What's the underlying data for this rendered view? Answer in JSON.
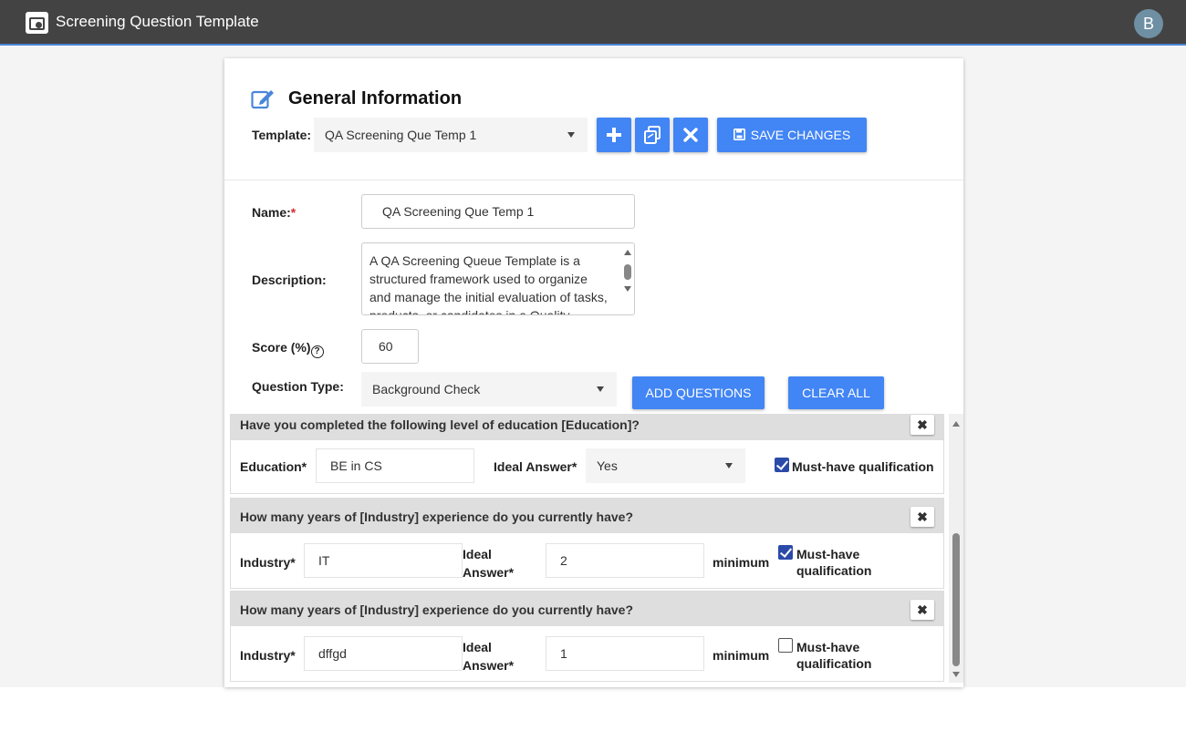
{
  "app": {
    "title": "Screening Question Template",
    "avatar_initial": "B"
  },
  "general": {
    "section_title": "General Information",
    "template_label": "Template:",
    "template_selected": "QA Screening Que Temp 1",
    "save_label": "SAVE CHANGES"
  },
  "form": {
    "name_label": "Name:",
    "name_required_mark": "*",
    "name_value": "QA Screening Que Temp 1",
    "description_label": "Description:",
    "description_value": "A QA Screening Queue Template is a structured framework used to organize and manage the initial evaluation of tasks, products, or candidates in a Quality",
    "score_label": "Score (%)",
    "score_help_icon": "?",
    "score_value": "60",
    "question_type_label": "Question Type:",
    "question_type_selected": "Background Check",
    "add_questions_label": "ADD QUESTIONS",
    "clear_all_label": "CLEAR ALL"
  },
  "questions": [
    {
      "title": "Have you completed the following level of education [Education]?",
      "field_label": "Education*",
      "field_value": "BE in CS",
      "ideal_label": "Ideal Answer*",
      "ideal_value": "Yes",
      "must_have_label": "Must-have qualification",
      "must_have": true
    },
    {
      "title": "How many years of [Industry] experience do you currently have?",
      "field_label": "Industry*",
      "field_value": "IT",
      "ideal_label_line1": "Ideal",
      "ideal_label_line2": "Answer*",
      "ideal_value": "2",
      "minimum_label": "minimum",
      "must_have_line1": "Must-have",
      "must_have_line2": "qualification",
      "must_have": true
    },
    {
      "title": "How many years of [Industry] experience do you currently have?",
      "field_label": "Industry*",
      "field_value": "dffgd",
      "ideal_label_line1": "Ideal",
      "ideal_label_line2": "Answer*",
      "ideal_value": "1",
      "minimum_label": "minimum",
      "must_have_line1": "Must-have",
      "must_have_line2": "qualification",
      "must_have": false
    }
  ],
  "icons": {
    "app": "app-logo-icon",
    "edit": "edit-pencil-icon",
    "add": "plus-icon",
    "copy": "copy-icon",
    "delete": "close-icon",
    "save": "floppy-disk-icon",
    "remove_question": "close-icon"
  },
  "colors": {
    "topbar": "#434343",
    "primary_button": "#4285f4",
    "checkbox_checked": "#2b4aa8",
    "question_header": "#dedede",
    "required": "#d32f2f"
  }
}
